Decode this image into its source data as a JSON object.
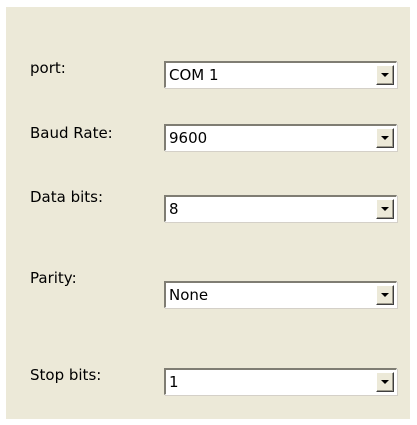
{
  "fields": [
    {
      "label": "port:",
      "value": "COM 1"
    },
    {
      "label": "Baud Rate:",
      "value": "9600"
    },
    {
      "label": "Data bits:",
      "value": "8"
    },
    {
      "label": "Parity:",
      "value": "None"
    },
    {
      "label": "Stop bits:",
      "value": "1"
    }
  ]
}
